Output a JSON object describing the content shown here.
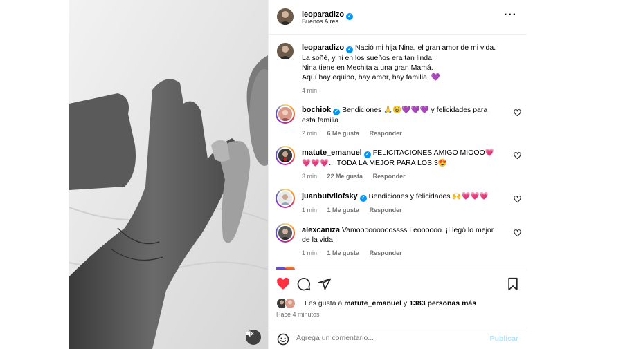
{
  "post": {
    "author": "leoparadizo",
    "location": "Buenos Aires",
    "caption_lines": [
      "Nació mi hija Nina, el gran amor de mi vida.",
      "La soñé, y ni en los sueños era tan linda.",
      "Nina tiene en Mechita a una gran Mamá.",
      "Aquí hay equipo, hay amor, hay familia. 💜"
    ],
    "caption_time": "4 min"
  },
  "comments": [
    {
      "user": "bochiok",
      "text": "Bendiciones 🙏🥹💜💜💜 y felicidades para esta familia",
      "time": "2 min",
      "likes": "6 Me gusta",
      "reply": "Responder"
    },
    {
      "user": "matute_emanuel",
      "text": "FELICITACIONES AMIGO MIOOO💗💗💗💗... TODA LA MEJOR PARA LOS 3😍",
      "time": "3 min",
      "likes": "22 Me gusta",
      "reply": "Responder"
    },
    {
      "user": "juanbutvilofsky",
      "text": "Bendiciones y felicidades 🙌💗💗💗",
      "time": "1 min",
      "likes": "1 Me gusta",
      "reply": "Responder"
    },
    {
      "user": "alexcaniza",
      "text": "Vamooooooooossss Leoooooo. ¡Llegó lo mejor de la vida!",
      "time": "1 min",
      "likes": "1 Me gusta",
      "reply": "Responder"
    }
  ],
  "likes": {
    "prefix": "Les gusta a",
    "user": "matute_emanuel",
    "middle": "y",
    "count": "1383 personas más",
    "time_ago": "Hace 4 minutos"
  },
  "comment_box": {
    "placeholder": "Agrega un comentario...",
    "publish": "Publicar"
  },
  "icons": {
    "like": "heart-filled-icon",
    "comment": "comment-icon",
    "share": "send-icon",
    "save": "bookmark-icon",
    "emoji": "emoji-icon",
    "more": "more-options-icon",
    "mute": "speaker-muted-icon"
  },
  "colors": {
    "like_red": "#ff3040",
    "verified_blue": "#0095f6",
    "publish_disabled": "#b2dffc",
    "muted_text": "#737373"
  }
}
